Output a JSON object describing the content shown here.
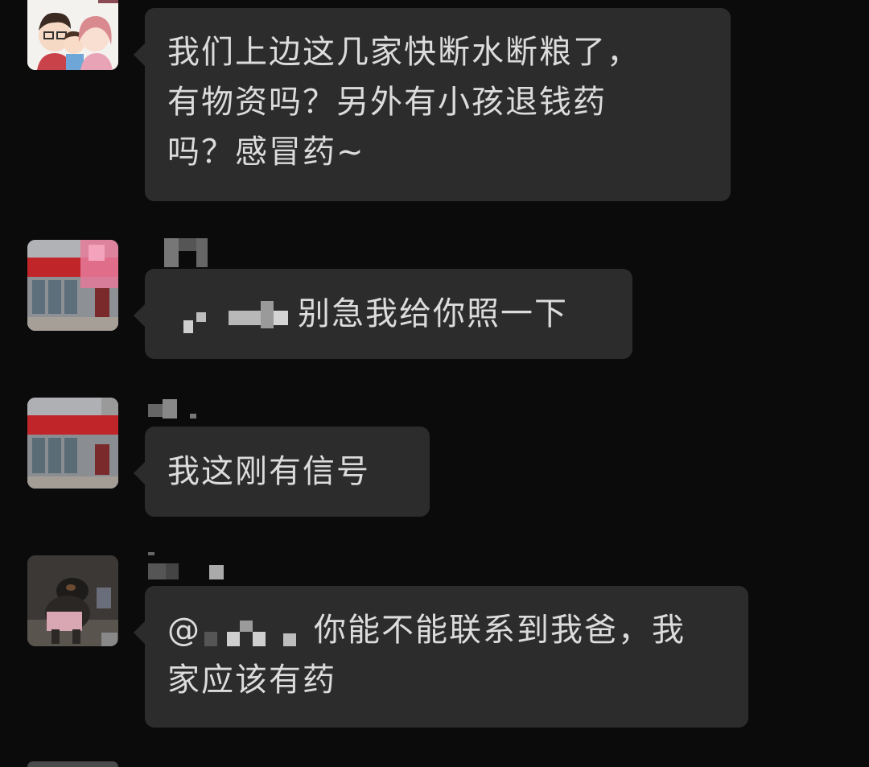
{
  "messages": [
    {
      "text_lines": [
        "我们上边这几家快断水断粮了，",
        "有物资吗？另外有小孩退钱药",
        "吗？感冒药~"
      ]
    },
    {
      "text": "别急我给你照一下"
    },
    {
      "text": "我这刚有信号"
    },
    {
      "prefix": "@",
      "text_line1": "你能不能联系到我爸，我",
      "text_line2": "家应该有药"
    }
  ],
  "icons": {
    "avatar1": "cartoon-family-avatar",
    "avatar2": "storefront-photo-avatar",
    "avatar3": "storefront-photo-avatar",
    "avatar4": "dog-photo-avatar"
  }
}
